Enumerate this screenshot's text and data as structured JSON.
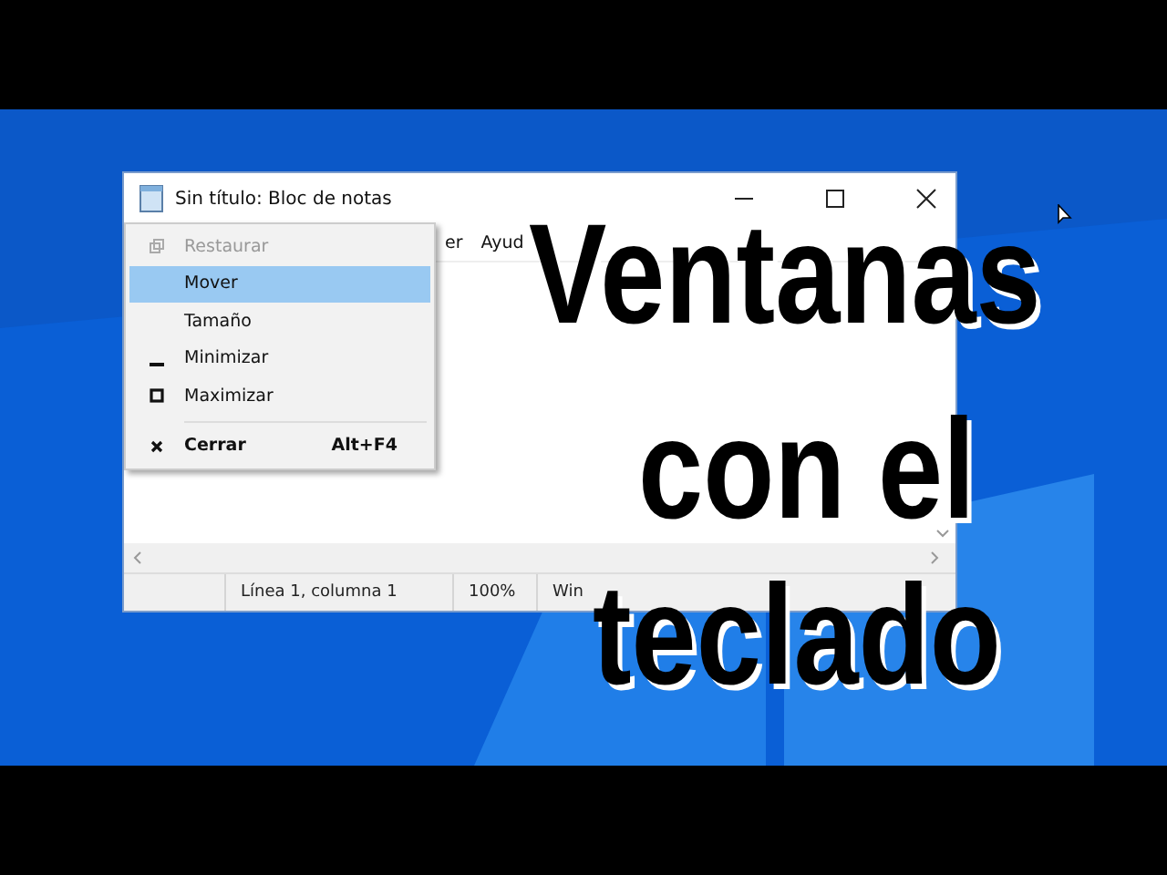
{
  "window": {
    "title": "Sin título: Bloc de notas",
    "menu_bar": [
      "er",
      "Ayud"
    ]
  },
  "system_menu": [
    {
      "kind": "restore",
      "label": "Restaurar",
      "disabled": true,
      "selected": false,
      "default": false,
      "separator_before": false
    },
    {
      "kind": "move",
      "label": "Mover",
      "disabled": false,
      "selected": true,
      "default": false,
      "separator_before": false
    },
    {
      "kind": "size",
      "label": "Tamaño",
      "disabled": false,
      "selected": false,
      "default": false,
      "separator_before": false
    },
    {
      "kind": "minimize",
      "label": "Minimizar",
      "disabled": false,
      "selected": false,
      "default": false,
      "separator_before": false
    },
    {
      "kind": "maximize",
      "label": "Maximizar",
      "disabled": false,
      "selected": false,
      "default": false,
      "separator_before": false
    },
    {
      "kind": "close",
      "label": "Cerrar",
      "shortcut": "Alt+F4",
      "disabled": false,
      "selected": false,
      "default": true,
      "separator_before": true
    }
  ],
  "status_bar": [
    "Línea 1, columna 1",
    "100%",
    "Win"
  ],
  "overlay_title": [
    "Ventanas",
    "con el",
    "teclado"
  ]
}
